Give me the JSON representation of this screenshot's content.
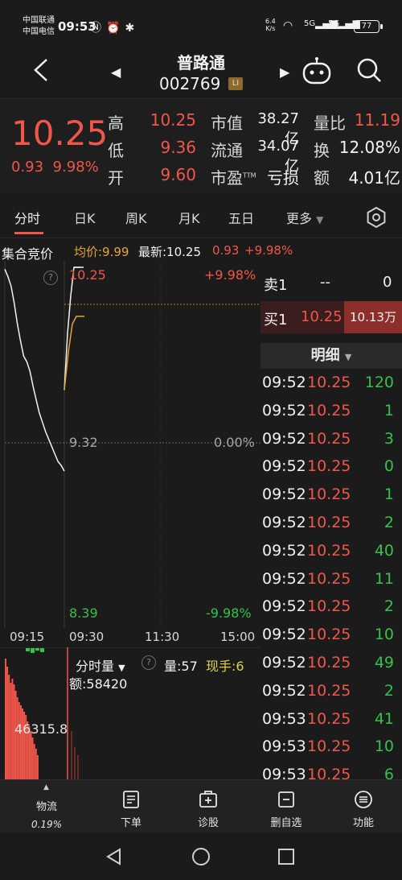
{
  "status_bar": {
    "carrier1": "中国联通",
    "carrier2": "中国电信",
    "time": "09:53",
    "net_speed_value": "6.4",
    "net_speed_unit": "K/s",
    "sig1": "5G",
    "sig2": "5G",
    "battery": "77"
  },
  "header": {
    "stock_name": "普路通",
    "stock_code": "002769",
    "badge": "LI"
  },
  "quote": {
    "price": "10.25",
    "change": "0.93",
    "change_pct": "9.98%",
    "high_label": "高",
    "high": "10.25",
    "low_label": "低",
    "low": "9.36",
    "open_label": "开",
    "open": "9.60",
    "mktcap_label": "市值",
    "mktcap": "38.27亿",
    "float_label": "流通",
    "float": "34.07亿",
    "pe_label": "市盈",
    "pe_sup": "TTM",
    "pe": "亏损",
    "volratio_label": "量比",
    "volratio": "11.19",
    "turnover_label": "换",
    "turnover": "12.08%",
    "amount_label": "额",
    "amount": "4.01亿"
  },
  "tabs": [
    {
      "label": "分时",
      "active": true
    },
    {
      "label": "日K"
    },
    {
      "label": "周K"
    },
    {
      "label": "月K"
    },
    {
      "label": "五日"
    },
    {
      "label": "更多"
    }
  ],
  "chart_info": {
    "auction": "集合竞价",
    "avg": "均价:9.99",
    "latest": "最新:10.25",
    "chg": "0.93",
    "pct": "+9.98%"
  },
  "chart_data": {
    "type": "line",
    "price_top": "10.25",
    "price_mid": "9.32",
    "price_bottom": "8.39",
    "pct_top": "+9.98%",
    "pct_mid": "0.00%",
    "pct_bottom": "-9.98%",
    "ylim": [
      8.39,
      10.25
    ],
    "times": [
      "09:15",
      "09:30",
      "11:30",
      "15:00"
    ],
    "volume_label": "分时量",
    "volume_value": "量:57",
    "volume_hand": "现手:6",
    "amount_value": "额:58420",
    "volume_axis": "46315.8",
    "auction_series": [
      10.24,
      10.2,
      10.15,
      10.06,
      9.95,
      9.86,
      9.78,
      9.75,
      9.7,
      9.62,
      9.55,
      9.48,
      9.43,
      9.38,
      9.34,
      9.3,
      9.26,
      9.22,
      9.2,
      9.17
    ],
    "session_price": [
      9.6,
      9.9,
      10.1,
      10.25,
      10.25,
      10.25
    ],
    "session_avg": [
      9.6,
      9.8,
      9.95,
      9.99,
      9.99,
      9.99
    ]
  },
  "order_book": {
    "sell_label": "卖1",
    "sell_price": "--",
    "sell_vol": "0",
    "buy_label": "买1",
    "buy_price": "10.25",
    "buy_vol": "10.13万"
  },
  "detail": {
    "title": "明细",
    "rows": [
      {
        "time": "09:52",
        "price": "10.25",
        "vol": "120",
        "dir": "green"
      },
      {
        "time": "09:52",
        "price": "10.25",
        "vol": "1",
        "dir": "green"
      },
      {
        "time": "09:52",
        "price": "10.25",
        "vol": "3",
        "dir": "green"
      },
      {
        "time": "09:52",
        "price": "10.25",
        "vol": "0",
        "dir": "green"
      },
      {
        "time": "09:52",
        "price": "10.25",
        "vol": "1",
        "dir": "green"
      },
      {
        "time": "09:52",
        "price": "10.25",
        "vol": "2",
        "dir": "green"
      },
      {
        "time": "09:52",
        "price": "10.25",
        "vol": "40",
        "dir": "green"
      },
      {
        "time": "09:52",
        "price": "10.25",
        "vol": "11",
        "dir": "green"
      },
      {
        "time": "09:52",
        "price": "10.25",
        "vol": "2",
        "dir": "green"
      },
      {
        "time": "09:52",
        "price": "10.25",
        "vol": "10",
        "dir": "green"
      },
      {
        "time": "09:52",
        "price": "10.25",
        "vol": "49",
        "dir": "green"
      },
      {
        "time": "09:52",
        "price": "10.25",
        "vol": "2",
        "dir": "green"
      },
      {
        "time": "09:53",
        "price": "10.25",
        "vol": "41",
        "dir": "green"
      },
      {
        "time": "09:53",
        "price": "10.25",
        "vol": "10",
        "dir": "green"
      },
      {
        "time": "09:53",
        "price": "10.25",
        "vol": "6",
        "dir": "green"
      }
    ]
  },
  "toolbar": {
    "logistics": "物流",
    "logistics_pct": "0.19%",
    "order": "下单",
    "diagnose": "诊股",
    "remove_watch": "删自选",
    "functions": "功能"
  },
  "colors": {
    "up": "#f0564a",
    "down": "#35c24a",
    "avg_line": "#e8a53a",
    "price_line": "#f2f2f2"
  }
}
